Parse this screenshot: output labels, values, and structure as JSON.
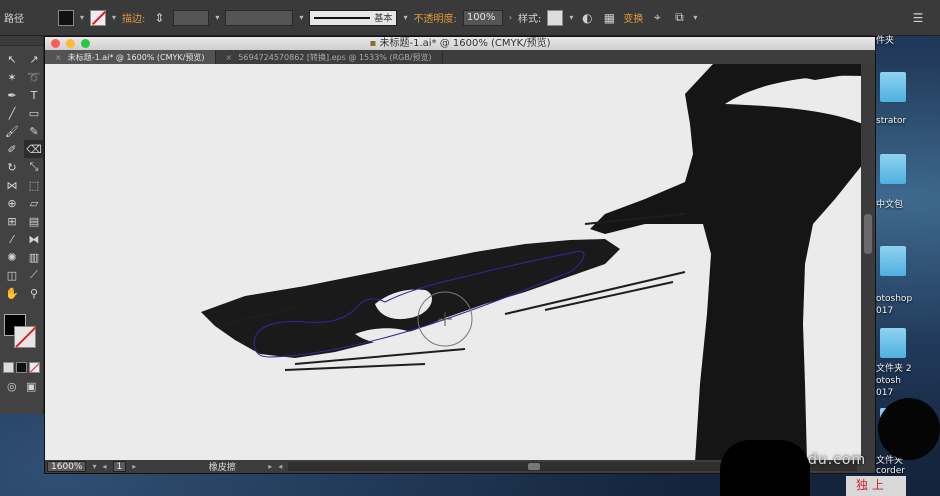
{
  "app": {
    "control_bar": {
      "object_label": "路径",
      "stroke_label": "描边:",
      "stroke_profile": "基本",
      "opacity_label": "不透明度:",
      "opacity_value": "100%",
      "style_label": "样式:",
      "transform_label": "变换"
    },
    "document": {
      "window_title": "未标题-1.ai* @ 1600% (CMYK/预览)",
      "tabs": [
        {
          "label": "未标题-1.ai* @ 1600% (CMYK/预览)",
          "active": true
        },
        {
          "label": "5694724570862 [转换].eps @ 1533% (RGB/预览)",
          "active": false
        }
      ],
      "status": {
        "zoom": "1600%",
        "artboard": "1",
        "tool_name": "橡皮擦"
      }
    },
    "desktop_icons": [
      {
        "label": "件夹"
      },
      {
        "label": "strator"
      },
      {
        "label": "中文包"
      },
      {
        "label": "otoshop"
      },
      {
        "label": "017"
      },
      {
        "label": "文件夹 2"
      },
      {
        "label": "otosh"
      },
      {
        "label": "017"
      },
      {
        "label": "文件夹"
      },
      {
        "label": "corder"
      }
    ],
    "watermark": "du.com",
    "corner_mark": "独 上"
  },
  "colors": {
    "accent_orange": "#e09a3a",
    "stroke_none_red": "#dd2222",
    "ink": "#151515",
    "path_outline": "#2a2aa0"
  },
  "icons": [
    "selection-tool-icon",
    "direct-selection-icon",
    "magic-wand-icon",
    "lasso-icon",
    "pen-tool-icon",
    "type-tool-icon",
    "line-tool-icon",
    "rectangle-tool-icon",
    "paintbrush-icon",
    "pencil-icon",
    "shaper-icon",
    "eraser-icon",
    "rotate-icon",
    "scale-icon",
    "width-icon",
    "free-transform-icon",
    "shape-builder-icon",
    "perspective-icon",
    "mesh-icon",
    "gradient-icon",
    "eyedropper-icon",
    "blend-icon",
    "symbol-sprayer-icon",
    "column-graph-icon",
    "artboard-icon",
    "slice-icon",
    "hand-icon",
    "zoom-icon"
  ]
}
